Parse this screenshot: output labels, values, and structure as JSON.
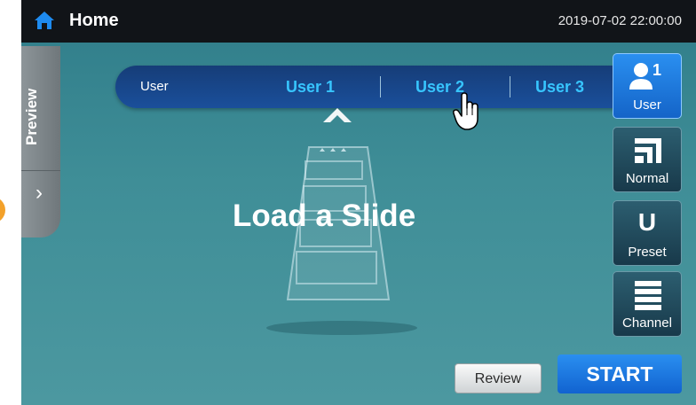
{
  "header": {
    "title": "Home",
    "datetime": "2019-07-02  22:00:00"
  },
  "sidebar": {
    "preview_label": "Preview",
    "expand_icon": "chevron-right-icon"
  },
  "user_bar": {
    "label": "User",
    "options": [
      "User 1",
      "User 2",
      "User 3"
    ],
    "selected": "User 2"
  },
  "main": {
    "message": "Load a Slide"
  },
  "side_buttons": [
    {
      "label": "User",
      "icon": "user-icon",
      "badge": "1",
      "active": true
    },
    {
      "label": "Normal",
      "icon": "normal-mode-icon",
      "active": false
    },
    {
      "label": "Preset",
      "icon": "preset-u-icon",
      "glyph": "U",
      "active": false
    },
    {
      "label": "Channel",
      "icon": "channel-list-icon",
      "active": false
    }
  ],
  "footer": {
    "review_label": "Review",
    "start_label": "START"
  },
  "colors": {
    "accent": "#1a7ae0",
    "user_option": "#37c5ff",
    "bar": "#1a4f9b",
    "indicator": "#f3a12a"
  }
}
